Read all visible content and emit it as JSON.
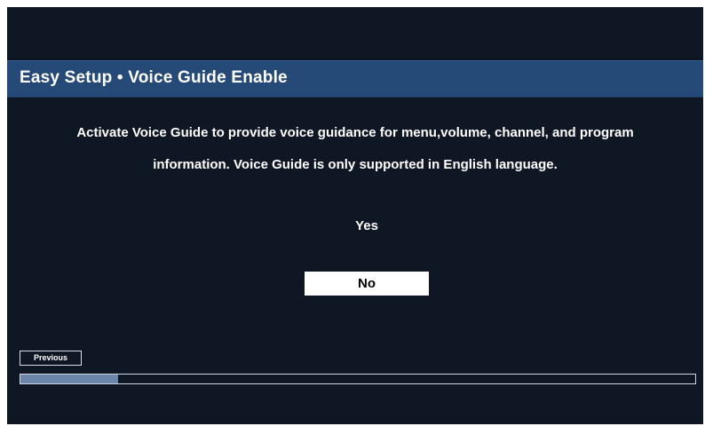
{
  "header": {
    "title": "Easy Setup • Voice Guide Enable"
  },
  "message": {
    "text": "Activate Voice Guide to provide voice guidance for menu,volume, channel, and program information. Voice Guide is only supported in English language."
  },
  "options": {
    "yes_label": "Yes",
    "no_label": "No",
    "selected": "No"
  },
  "footer": {
    "previous_label": "Previous",
    "progress_fraction": 0.145
  },
  "colors": {
    "background": "#0f1724",
    "title_bar": "#264a78",
    "progress_fill": "#6b86a8",
    "selection_highlight": "#ffffff"
  }
}
